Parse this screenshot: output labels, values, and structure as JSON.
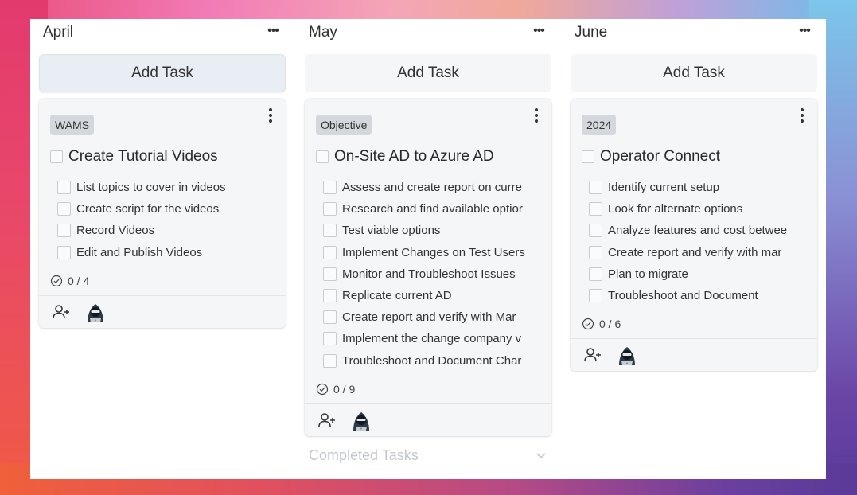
{
  "columns": [
    {
      "title": "April",
      "add_task_label": "Add Task",
      "card": {
        "tag": "WAMS",
        "title": "Create Tutorial Videos",
        "subtasks": [
          "List topics to cover in videos",
          "Create script for the videos",
          "Record Videos",
          "Edit and Publish Videos"
        ],
        "progress": "0 / 4"
      }
    },
    {
      "title": "May",
      "add_task_label": "Add Task",
      "card": {
        "tag": "Objective",
        "title": "On-Site AD to Azure AD",
        "subtasks": [
          "Assess and create report on curre",
          "Research and find available optior",
          "Test viable options",
          "Implement Changes on Test Users",
          "Monitor and Troubleshoot Issues",
          "Replicate current AD",
          "Create report and verify with Mar",
          "Implement the change company v",
          "Troubleshoot and Document Char"
        ],
        "progress": "0 / 9"
      },
      "completed_label": "Completed Tasks"
    },
    {
      "title": "June",
      "add_task_label": "Add Task",
      "card": {
        "tag": "2024",
        "title": "Operator Connect",
        "subtasks": [
          "Identify current setup",
          "Look for alternate options",
          "Analyze features and cost betwee",
          "Create report and verify with mar",
          "Plan to migrate",
          "Troubleshoot and Document"
        ],
        "progress": "0 / 6"
      }
    }
  ],
  "icons": {
    "column_menu": "ellipsis-horizontal-icon",
    "card_menu": "ellipsis-vertical-icon",
    "progress": "check-circle-icon",
    "assign": "add-person-icon",
    "avatar": "hacker-avatar-icon",
    "expand": "chevron-down-icon"
  },
  "colors": {
    "card_bg": "#f4f6f8",
    "tag_bg": "#d4d8dd",
    "completed_text": "#c3c7cd"
  }
}
